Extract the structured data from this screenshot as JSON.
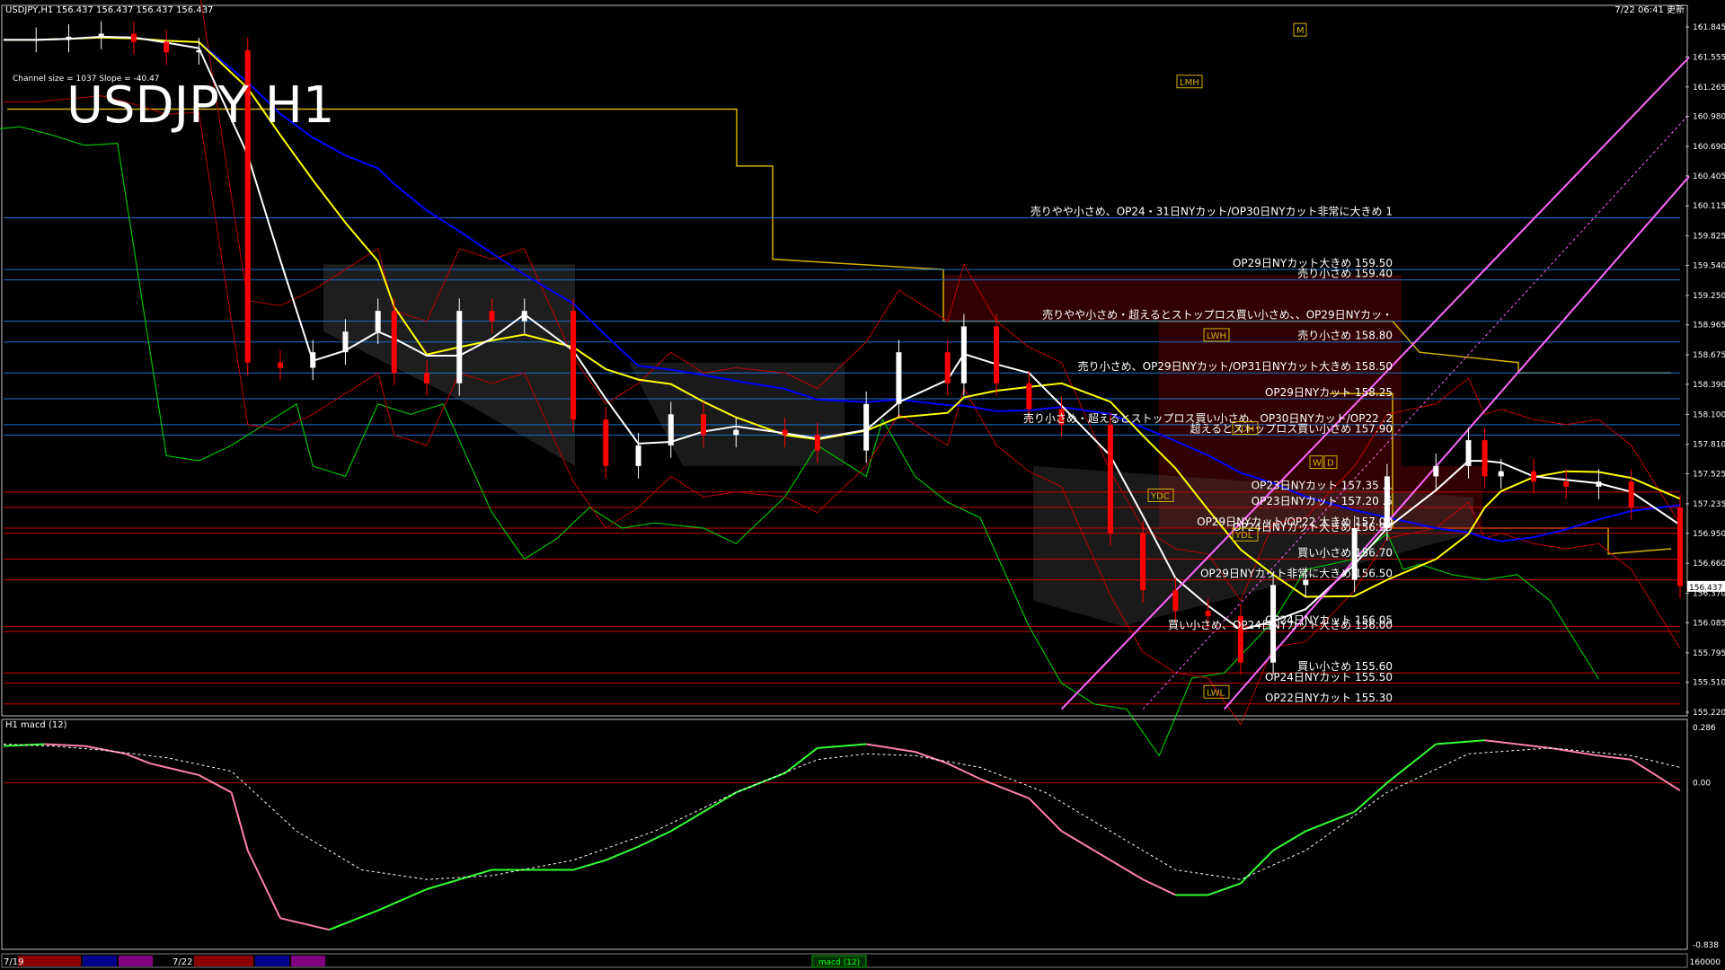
{
  "header": {
    "symbol_info": "USDJPY,H1  156.437 156.437 156.437 156.437",
    "clock": "7/22 06:41 更新",
    "big_title": "USDJPY H1",
    "channel_info": "Channel size = 1037  Slope = -40.47"
  },
  "colors": {
    "background": "#000000",
    "price_frame": "#c0c0c0",
    "bull_candle": "#ffffff",
    "bear_candle": "#ff0000",
    "sma_white": "#ffffff",
    "sma_yellow": "#ffff00",
    "sma_blue": "#0000ff",
    "chikou_green": "#00c000",
    "bollinger_red": "#c00000",
    "cloud_yellow": "#d4b000",
    "channel_pink": "#ff66ff",
    "macd_up": "#33ff33",
    "macd_down": "#ff80b0",
    "macd_signal": "#ffffff",
    "macd_zero": "#c00000"
  },
  "chart_data": [
    {
      "type": "line",
      "title": "USDJPY H1",
      "price_axis": {
        "ylim": [
          155.22,
          161.845
        ],
        "ticks": [
          "161.845",
          "161.555",
          "161.265",
          "160.980",
          "160.690",
          "160.405",
          "160.115",
          "159.825",
          "159.540",
          "159.250",
          "158.965",
          "158.675",
          "158.390",
          "158.100",
          "157.810",
          "157.525",
          "157.235",
          "156.950",
          "156.660",
          "156.370",
          "156.085",
          "155.795",
          "155.510",
          "155.220"
        ],
        "current_price": "156.437"
      },
      "series": [
        {
          "name": "close",
          "x": [
            0,
            4,
            8,
            12,
            16,
            20,
            24,
            30,
            34,
            38,
            42,
            46,
            48,
            52,
            56,
            60,
            64,
            70,
            74,
            78,
            82,
            86,
            90,
            96,
            100,
            106,
            110,
            116,
            118,
            122,
            126,
            130,
            136,
            140,
            144,
            148,
            152,
            156,
            160,
            166,
            170,
            176,
            180,
            182,
            184,
            188,
            192,
            196,
            200,
            206
          ],
          "values": [
            161.72,
            161.72,
            161.75,
            161.78,
            161.7,
            161.6,
            161.62,
            158.6,
            158.55,
            158.7,
            158.9,
            159.1,
            158.5,
            158.4,
            159.1,
            159.0,
            159.1,
            158.05,
            157.6,
            157.8,
            158.1,
            157.9,
            157.95,
            157.9,
            157.75,
            158.2,
            158.7,
            158.4,
            158.95,
            158.4,
            158.15,
            158.0,
            156.95,
            156.4,
            156.2,
            156.15,
            155.7,
            156.45,
            156.5,
            157.0,
            157.5,
            157.6,
            157.85,
            157.5,
            157.55,
            157.45,
            157.4,
            157.45,
            157.2,
            156.44
          ]
        }
      ],
      "horizontal_levels": [
        {
          "label": "売りやや小さめ、OP24・31日NYカット/OP30日NYカット非常に大きめ 1",
          "price": 160.0
        },
        {
          "label": "OP29日NYカット大きめ 159.50",
          "price": 159.5
        },
        {
          "label": "売り小さめ 159.40",
          "price": 159.4
        },
        {
          "label": "売りやや小さめ・超えるとストップロス買い小さめ、、OP29日NYカッ・",
          "price": 159.0
        },
        {
          "label": "売り小さめ 158.80",
          "price": 158.8
        },
        {
          "label": "売り小さめ、OP29日NYカット/OP31日NYカット大きめ 158.50",
          "price": 158.5
        },
        {
          "label": "OP29日NYカット 158.25",
          "price": 158.25
        },
        {
          "label": "売り小さめ・超えるとストップロス買い小さめ、OP30日NYカット/OP22 .2",
          "price": 158.0
        },
        {
          "label": "超えるとストップロス買い小さめ 157.90",
          "price": 157.9
        },
        {
          "label": "OP23日NYカット 157.35 .1",
          "price": 157.35
        },
        {
          "label": "OP23日NYカット 157.20 .5",
          "price": 157.2
        },
        {
          "label": "OP29日NYカット/OP22 大きめ 157.00",
          "price": 157.0
        },
        {
          "label": "OP24日NYカット大きめ 156.95",
          "price": 156.95
        },
        {
          "label": "買い小さめ 156.70",
          "price": 156.7
        },
        {
          "label": "OP29日NYカット非常に大きめ 156.50",
          "price": 156.5
        },
        {
          "label": "OP24日NYカット 156.05",
          "price": 156.05
        },
        {
          "label": "買い小さめ、OP24日NYカット大きめ 156.00",
          "price": 156.0
        },
        {
          "label": "買い小さめ 155.60",
          "price": 155.6
        },
        {
          "label": "OP24日NYカット 155.50",
          "price": 155.5
        },
        {
          "label": "OP22日NYカット 155.30",
          "price": 155.3
        }
      ],
      "level_tags": [
        "LMH",
        "LWH",
        "YDH",
        "YDC",
        "YDL",
        "LWL",
        "W",
        "D",
        "M"
      ]
    },
    {
      "type": "line",
      "title": "H1  macd (12)",
      "ylim": [
        -0.838,
        0.286
      ],
      "ticks": [
        "0.286",
        "0.00",
        "-0.838"
      ],
      "series": [
        {
          "name": "macd",
          "x": [
            0,
            5,
            10,
            15,
            18,
            20,
            24,
            28,
            30,
            34,
            40,
            46,
            52,
            60,
            70,
            74,
            78,
            82,
            86,
            90,
            96,
            100,
            106,
            112,
            116,
            120,
            126,
            130,
            140,
            144,
            148,
            152,
            156,
            160,
            166,
            170,
            176,
            182,
            186,
            190,
            196,
            200,
            206
          ],
          "values": [
            0.19,
            0.2,
            0.19,
            0.15,
            0.1,
            0.08,
            0.04,
            -0.05,
            -0.35,
            -0.7,
            -0.76,
            -0.66,
            -0.55,
            -0.45,
            -0.45,
            -0.4,
            -0.33,
            -0.25,
            -0.15,
            -0.05,
            0.05,
            0.18,
            0.2,
            0.16,
            0.1,
            0.02,
            -0.08,
            -0.25,
            -0.5,
            -0.58,
            -0.58,
            -0.52,
            -0.35,
            -0.25,
            -0.15,
            0.0,
            0.2,
            0.22,
            0.2,
            0.18,
            0.14,
            0.12,
            -0.04
          ]
        },
        {
          "name": "signal",
          "x": [
            0,
            6,
            12,
            20,
            28,
            36,
            44,
            52,
            60,
            70,
            80,
            90,
            100,
            106,
            112,
            120,
            128,
            136,
            144,
            152,
            160,
            170,
            180,
            190,
            200,
            206
          ],
          "values": [
            0.2,
            0.19,
            0.17,
            0.13,
            0.06,
            -0.25,
            -0.45,
            -0.5,
            -0.48,
            -0.4,
            -0.25,
            -0.05,
            0.12,
            0.15,
            0.14,
            0.08,
            -0.05,
            -0.25,
            -0.45,
            -0.5,
            -0.35,
            -0.05,
            0.15,
            0.18,
            0.14,
            0.08
          ]
        }
      ]
    }
  ],
  "time_axis": {
    "labels": [
      "7/19",
      "7/22"
    ]
  },
  "bottom_tab": "macd (12)",
  "corner_value": "160000"
}
